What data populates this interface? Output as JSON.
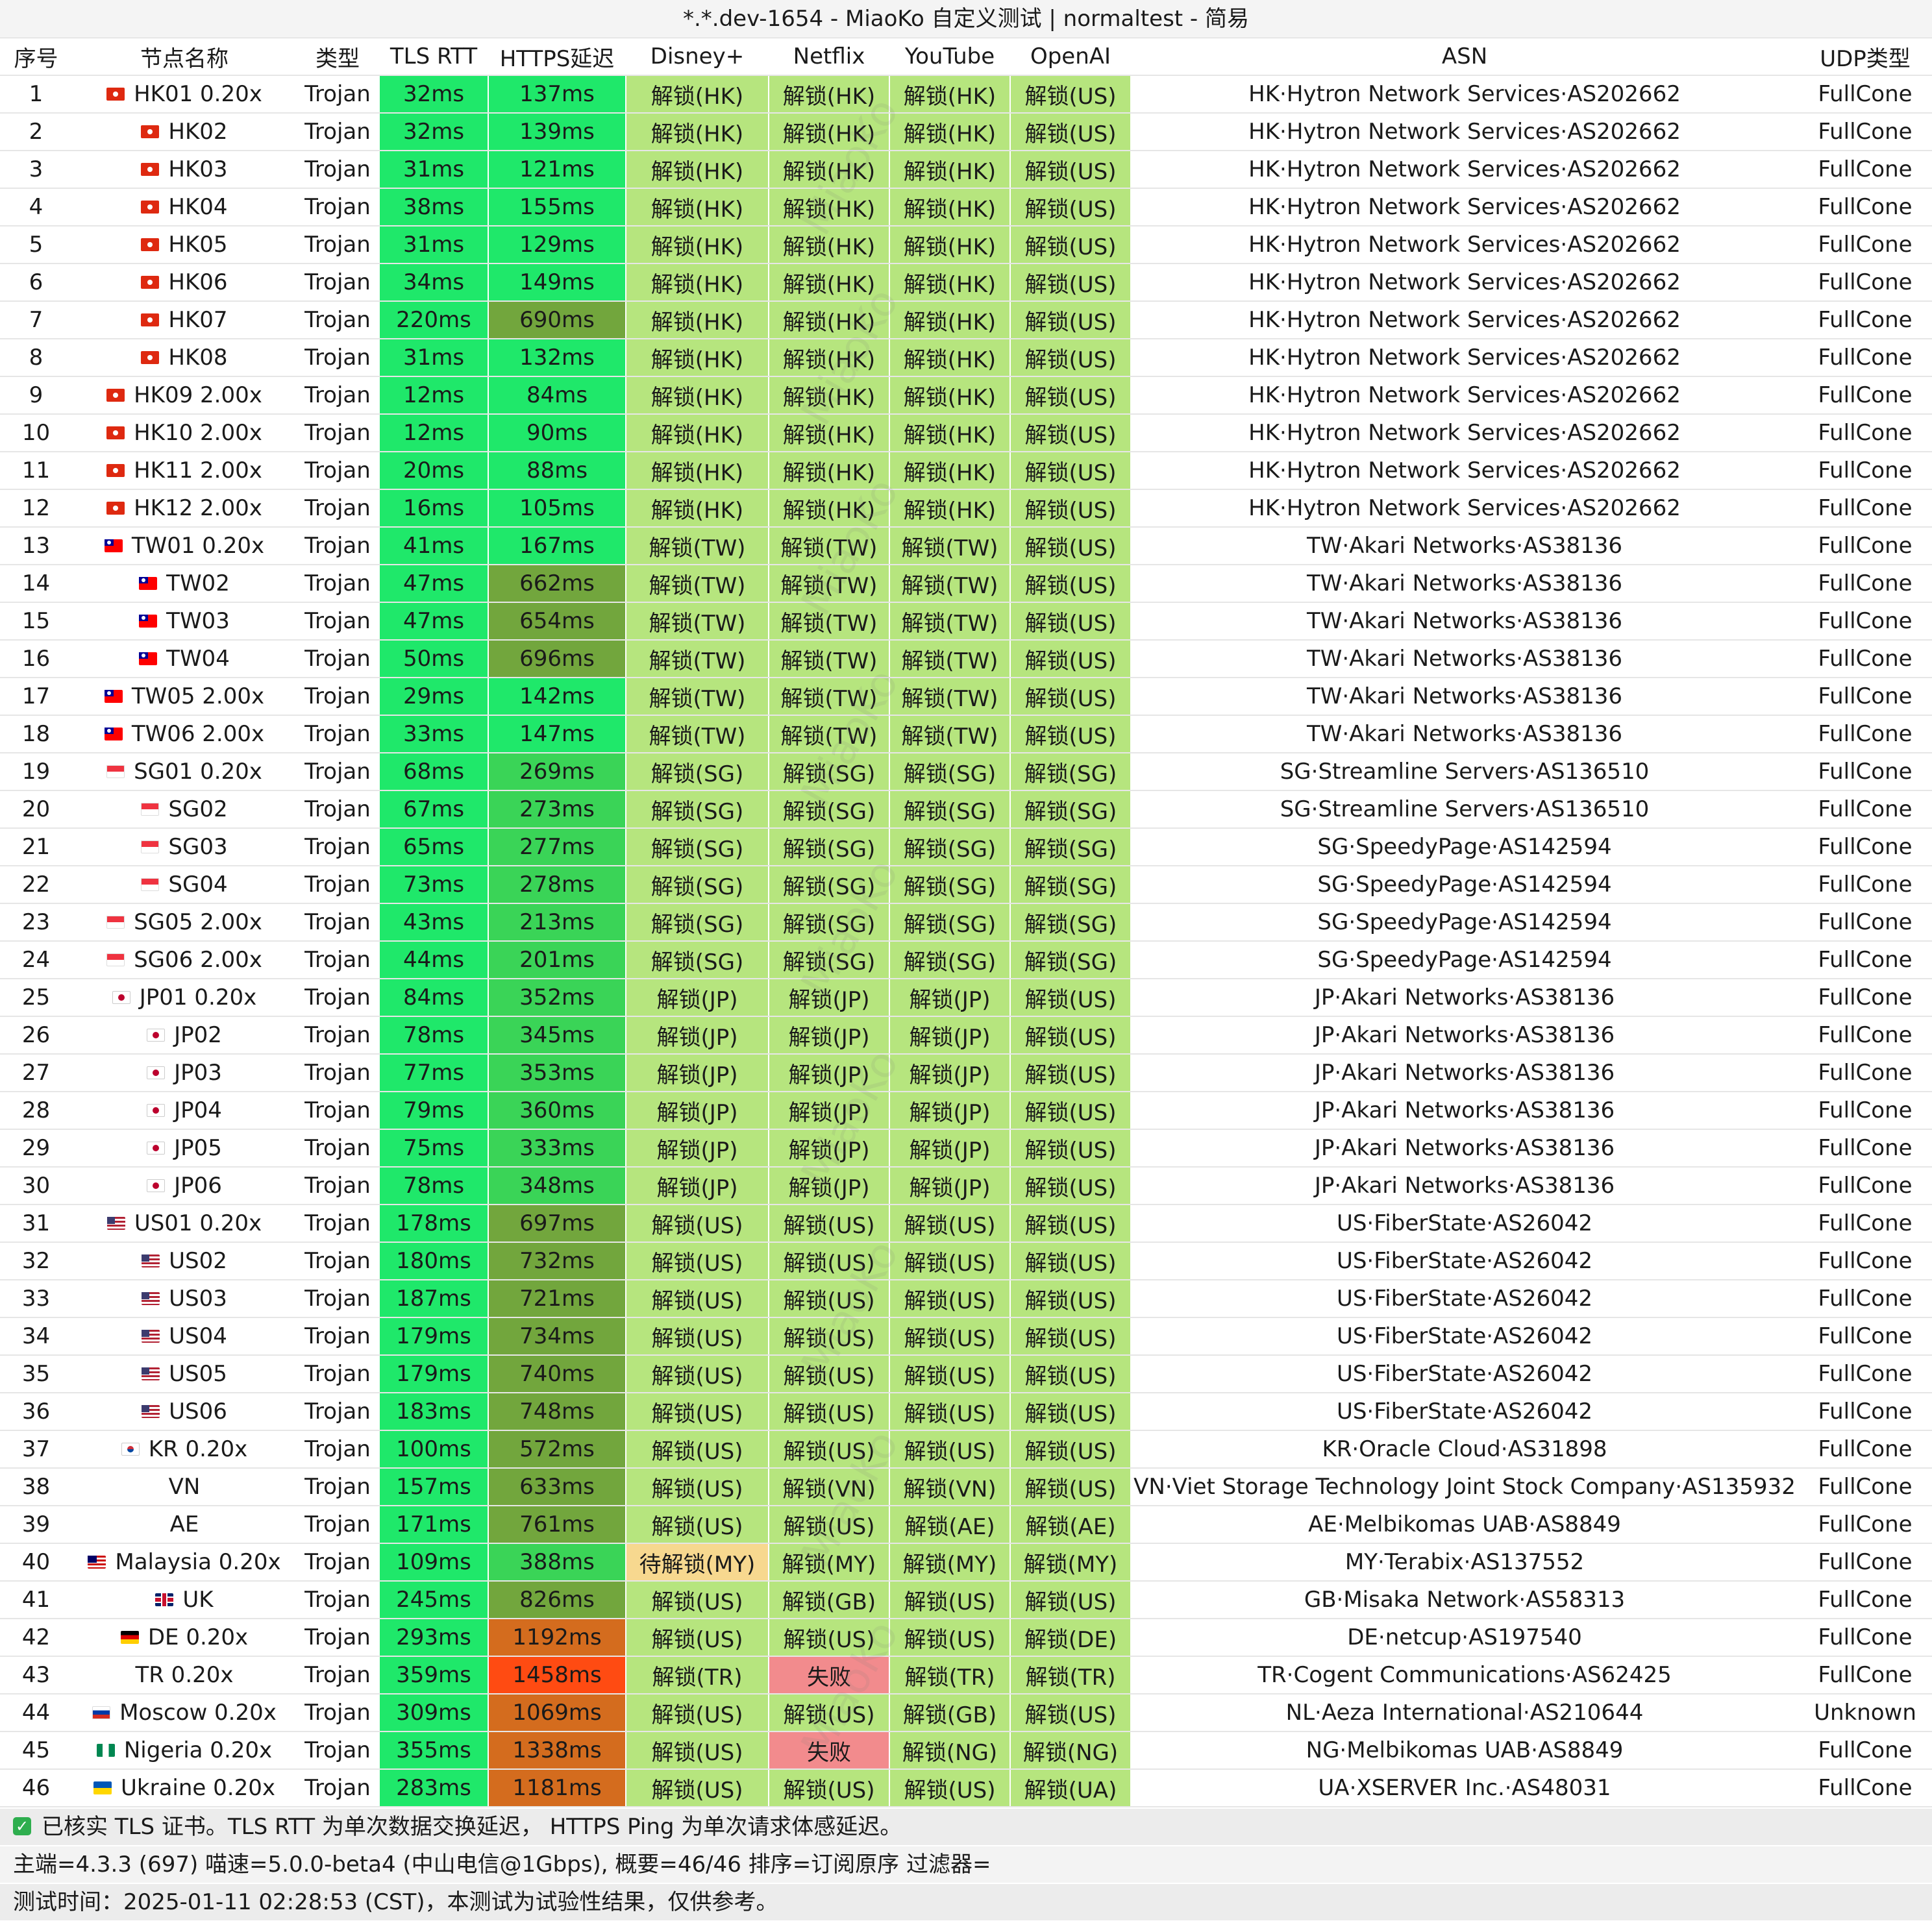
{
  "title": "*.*.dev-1654 - MiaoKo 自定义测试 | normaltest - 简易",
  "headers": [
    "序号",
    "节点名称",
    "类型",
    "TLS RTT",
    "HTTPS延迟",
    "Disney+",
    "Netflix",
    "YouTube",
    "OpenAI",
    "ASN",
    "UDP类型"
  ],
  "colors": {
    "tls_green": "#1fe86a",
    "unlock_green": "#b6e57e",
    "pending_yellow": "#f7d88f",
    "fail_red": "#f28b8d",
    "https_scale": [
      "#1fe86a",
      "#3ad457",
      "#72a63d",
      "#d46c1e",
      "#ff4b12"
    ]
  },
  "rows": [
    {
      "no": "1",
      "flag": "hk",
      "name": "HK01 0.20x",
      "type": "Trojan",
      "tls": "32ms",
      "https": "137ms",
      "https_level": 0,
      "disney": "解锁(HK)",
      "netflix": "解锁(HK)",
      "youtube": "解锁(HK)",
      "openai": "解锁(US)",
      "asn": "HK·Hytron Network Services·AS202662",
      "udp": "FullCone"
    },
    {
      "no": "2",
      "flag": "hk",
      "name": "HK02",
      "type": "Trojan",
      "tls": "32ms",
      "https": "139ms",
      "https_level": 0,
      "disney": "解锁(HK)",
      "netflix": "解锁(HK)",
      "youtube": "解锁(HK)",
      "openai": "解锁(US)",
      "asn": "HK·Hytron Network Services·AS202662",
      "udp": "FullCone"
    },
    {
      "no": "3",
      "flag": "hk",
      "name": "HK03",
      "type": "Trojan",
      "tls": "31ms",
      "https": "121ms",
      "https_level": 0,
      "disney": "解锁(HK)",
      "netflix": "解锁(HK)",
      "youtube": "解锁(HK)",
      "openai": "解锁(US)",
      "asn": "HK·Hytron Network Services·AS202662",
      "udp": "FullCone"
    },
    {
      "no": "4",
      "flag": "hk",
      "name": "HK04",
      "type": "Trojan",
      "tls": "38ms",
      "https": "155ms",
      "https_level": 0,
      "disney": "解锁(HK)",
      "netflix": "解锁(HK)",
      "youtube": "解锁(HK)",
      "openai": "解锁(US)",
      "asn": "HK·Hytron Network Services·AS202662",
      "udp": "FullCone"
    },
    {
      "no": "5",
      "flag": "hk",
      "name": "HK05",
      "type": "Trojan",
      "tls": "31ms",
      "https": "129ms",
      "https_level": 0,
      "disney": "解锁(HK)",
      "netflix": "解锁(HK)",
      "youtube": "解锁(HK)",
      "openai": "解锁(US)",
      "asn": "HK·Hytron Network Services·AS202662",
      "udp": "FullCone"
    },
    {
      "no": "6",
      "flag": "hk",
      "name": "HK06",
      "type": "Trojan",
      "tls": "34ms",
      "https": "149ms",
      "https_level": 0,
      "disney": "解锁(HK)",
      "netflix": "解锁(HK)",
      "youtube": "解锁(HK)",
      "openai": "解锁(US)",
      "asn": "HK·Hytron Network Services·AS202662",
      "udp": "FullCone"
    },
    {
      "no": "7",
      "flag": "hk",
      "name": "HK07",
      "type": "Trojan",
      "tls": "220ms",
      "https": "690ms",
      "https_level": 2,
      "disney": "解锁(HK)",
      "netflix": "解锁(HK)",
      "youtube": "解锁(HK)",
      "openai": "解锁(US)",
      "asn": "HK·Hytron Network Services·AS202662",
      "udp": "FullCone"
    },
    {
      "no": "8",
      "flag": "hk",
      "name": "HK08",
      "type": "Trojan",
      "tls": "31ms",
      "https": "132ms",
      "https_level": 0,
      "disney": "解锁(HK)",
      "netflix": "解锁(HK)",
      "youtube": "解锁(HK)",
      "openai": "解锁(US)",
      "asn": "HK·Hytron Network Services·AS202662",
      "udp": "FullCone"
    },
    {
      "no": "9",
      "flag": "hk",
      "name": "HK09 2.00x",
      "type": "Trojan",
      "tls": "12ms",
      "https": "84ms",
      "https_level": 0,
      "disney": "解锁(HK)",
      "netflix": "解锁(HK)",
      "youtube": "解锁(HK)",
      "openai": "解锁(US)",
      "asn": "HK·Hytron Network Services·AS202662",
      "udp": "FullCone"
    },
    {
      "no": "10",
      "flag": "hk",
      "name": "HK10 2.00x",
      "type": "Trojan",
      "tls": "12ms",
      "https": "90ms",
      "https_level": 0,
      "disney": "解锁(HK)",
      "netflix": "解锁(HK)",
      "youtube": "解锁(HK)",
      "openai": "解锁(US)",
      "asn": "HK·Hytron Network Services·AS202662",
      "udp": "FullCone"
    },
    {
      "no": "11",
      "flag": "hk",
      "name": "HK11 2.00x",
      "type": "Trojan",
      "tls": "20ms",
      "https": "88ms",
      "https_level": 0,
      "disney": "解锁(HK)",
      "netflix": "解锁(HK)",
      "youtube": "解锁(HK)",
      "openai": "解锁(US)",
      "asn": "HK·Hytron Network Services·AS202662",
      "udp": "FullCone"
    },
    {
      "no": "12",
      "flag": "hk",
      "name": "HK12 2.00x",
      "type": "Trojan",
      "tls": "16ms",
      "https": "105ms",
      "https_level": 0,
      "disney": "解锁(HK)",
      "netflix": "解锁(HK)",
      "youtube": "解锁(HK)",
      "openai": "解锁(US)",
      "asn": "HK·Hytron Network Services·AS202662",
      "udp": "FullCone"
    },
    {
      "no": "13",
      "flag": "tw",
      "name": "TW01 0.20x",
      "type": "Trojan",
      "tls": "41ms",
      "https": "167ms",
      "https_level": 0,
      "disney": "解锁(TW)",
      "netflix": "解锁(TW)",
      "youtube": "解锁(TW)",
      "openai": "解锁(US)",
      "asn": "TW·Akari Networks·AS38136",
      "udp": "FullCone"
    },
    {
      "no": "14",
      "flag": "tw",
      "name": "TW02",
      "type": "Trojan",
      "tls": "47ms",
      "https": "662ms",
      "https_level": 2,
      "disney": "解锁(TW)",
      "netflix": "解锁(TW)",
      "youtube": "解锁(TW)",
      "openai": "解锁(US)",
      "asn": "TW·Akari Networks·AS38136",
      "udp": "FullCone"
    },
    {
      "no": "15",
      "flag": "tw",
      "name": "TW03",
      "type": "Trojan",
      "tls": "47ms",
      "https": "654ms",
      "https_level": 2,
      "disney": "解锁(TW)",
      "netflix": "解锁(TW)",
      "youtube": "解锁(TW)",
      "openai": "解锁(US)",
      "asn": "TW·Akari Networks·AS38136",
      "udp": "FullCone"
    },
    {
      "no": "16",
      "flag": "tw",
      "name": "TW04",
      "type": "Trojan",
      "tls": "50ms",
      "https": "696ms",
      "https_level": 2,
      "disney": "解锁(TW)",
      "netflix": "解锁(TW)",
      "youtube": "解锁(TW)",
      "openai": "解锁(US)",
      "asn": "TW·Akari Networks·AS38136",
      "udp": "FullCone"
    },
    {
      "no": "17",
      "flag": "tw",
      "name": "TW05 2.00x",
      "type": "Trojan",
      "tls": "29ms",
      "https": "142ms",
      "https_level": 0,
      "disney": "解锁(TW)",
      "netflix": "解锁(TW)",
      "youtube": "解锁(TW)",
      "openai": "解锁(US)",
      "asn": "TW·Akari Networks·AS38136",
      "udp": "FullCone"
    },
    {
      "no": "18",
      "flag": "tw",
      "name": "TW06 2.00x",
      "type": "Trojan",
      "tls": "33ms",
      "https": "147ms",
      "https_level": 0,
      "disney": "解锁(TW)",
      "netflix": "解锁(TW)",
      "youtube": "解锁(TW)",
      "openai": "解锁(US)",
      "asn": "TW·Akari Networks·AS38136",
      "udp": "FullCone"
    },
    {
      "no": "19",
      "flag": "sg",
      "name": "SG01 0.20x",
      "type": "Trojan",
      "tls": "68ms",
      "https": "269ms",
      "https_level": 1,
      "disney": "解锁(SG)",
      "netflix": "解锁(SG)",
      "youtube": "解锁(SG)",
      "openai": "解锁(SG)",
      "asn": "SG·Streamline Servers·AS136510",
      "udp": "FullCone"
    },
    {
      "no": "20",
      "flag": "sg",
      "name": "SG02",
      "type": "Trojan",
      "tls": "67ms",
      "https": "273ms",
      "https_level": 1,
      "disney": "解锁(SG)",
      "netflix": "解锁(SG)",
      "youtube": "解锁(SG)",
      "openai": "解锁(SG)",
      "asn": "SG·Streamline Servers·AS136510",
      "udp": "FullCone"
    },
    {
      "no": "21",
      "flag": "sg",
      "name": "SG03",
      "type": "Trojan",
      "tls": "65ms",
      "https": "277ms",
      "https_level": 1,
      "disney": "解锁(SG)",
      "netflix": "解锁(SG)",
      "youtube": "解锁(SG)",
      "openai": "解锁(SG)",
      "asn": "SG·SpeedyPage·AS142594",
      "udp": "FullCone"
    },
    {
      "no": "22",
      "flag": "sg",
      "name": "SG04",
      "type": "Trojan",
      "tls": "73ms",
      "https": "278ms",
      "https_level": 1,
      "disney": "解锁(SG)",
      "netflix": "解锁(SG)",
      "youtube": "解锁(SG)",
      "openai": "解锁(SG)",
      "asn": "SG·SpeedyPage·AS142594",
      "udp": "FullCone"
    },
    {
      "no": "23",
      "flag": "sg",
      "name": "SG05 2.00x",
      "type": "Trojan",
      "tls": "43ms",
      "https": "213ms",
      "https_level": 1,
      "disney": "解锁(SG)",
      "netflix": "解锁(SG)",
      "youtube": "解锁(SG)",
      "openai": "解锁(SG)",
      "asn": "SG·SpeedyPage·AS142594",
      "udp": "FullCone"
    },
    {
      "no": "24",
      "flag": "sg",
      "name": "SG06 2.00x",
      "type": "Trojan",
      "tls": "44ms",
      "https": "201ms",
      "https_level": 1,
      "disney": "解锁(SG)",
      "netflix": "解锁(SG)",
      "youtube": "解锁(SG)",
      "openai": "解锁(SG)",
      "asn": "SG·SpeedyPage·AS142594",
      "udp": "FullCone"
    },
    {
      "no": "25",
      "flag": "jp",
      "name": "JP01 0.20x",
      "type": "Trojan",
      "tls": "84ms",
      "https": "352ms",
      "https_level": 1,
      "disney": "解锁(JP)",
      "netflix": "解锁(JP)",
      "youtube": "解锁(JP)",
      "openai": "解锁(US)",
      "asn": "JP·Akari Networks·AS38136",
      "udp": "FullCone"
    },
    {
      "no": "26",
      "flag": "jp",
      "name": "JP02",
      "type": "Trojan",
      "tls": "78ms",
      "https": "345ms",
      "https_level": 1,
      "disney": "解锁(JP)",
      "netflix": "解锁(JP)",
      "youtube": "解锁(JP)",
      "openai": "解锁(US)",
      "asn": "JP·Akari Networks·AS38136",
      "udp": "FullCone"
    },
    {
      "no": "27",
      "flag": "jp",
      "name": "JP03",
      "type": "Trojan",
      "tls": "77ms",
      "https": "353ms",
      "https_level": 1,
      "disney": "解锁(JP)",
      "netflix": "解锁(JP)",
      "youtube": "解锁(JP)",
      "openai": "解锁(US)",
      "asn": "JP·Akari Networks·AS38136",
      "udp": "FullCone"
    },
    {
      "no": "28",
      "flag": "jp",
      "name": "JP04",
      "type": "Trojan",
      "tls": "79ms",
      "https": "360ms",
      "https_level": 1,
      "disney": "解锁(JP)",
      "netflix": "解锁(JP)",
      "youtube": "解锁(JP)",
      "openai": "解锁(US)",
      "asn": "JP·Akari Networks·AS38136",
      "udp": "FullCone"
    },
    {
      "no": "29",
      "flag": "jp",
      "name": "JP05",
      "type": "Trojan",
      "tls": "75ms",
      "https": "333ms",
      "https_level": 1,
      "disney": "解锁(JP)",
      "netflix": "解锁(JP)",
      "youtube": "解锁(JP)",
      "openai": "解锁(US)",
      "asn": "JP·Akari Networks·AS38136",
      "udp": "FullCone"
    },
    {
      "no": "30",
      "flag": "jp",
      "name": "JP06",
      "type": "Trojan",
      "tls": "78ms",
      "https": "348ms",
      "https_level": 1,
      "disney": "解锁(JP)",
      "netflix": "解锁(JP)",
      "youtube": "解锁(JP)",
      "openai": "解锁(US)",
      "asn": "JP·Akari Networks·AS38136",
      "udp": "FullCone"
    },
    {
      "no": "31",
      "flag": "us",
      "name": "US01 0.20x",
      "type": "Trojan",
      "tls": "178ms",
      "https": "697ms",
      "https_level": 2,
      "disney": "解锁(US)",
      "netflix": "解锁(US)",
      "youtube": "解锁(US)",
      "openai": "解锁(US)",
      "asn": "US·FiberState·AS26042",
      "udp": "FullCone"
    },
    {
      "no": "32",
      "flag": "us",
      "name": "US02",
      "type": "Trojan",
      "tls": "180ms",
      "https": "732ms",
      "https_level": 2,
      "disney": "解锁(US)",
      "netflix": "解锁(US)",
      "youtube": "解锁(US)",
      "openai": "解锁(US)",
      "asn": "US·FiberState·AS26042",
      "udp": "FullCone"
    },
    {
      "no": "33",
      "flag": "us",
      "name": "US03",
      "type": "Trojan",
      "tls": "187ms",
      "https": "721ms",
      "https_level": 2,
      "disney": "解锁(US)",
      "netflix": "解锁(US)",
      "youtube": "解锁(US)",
      "openai": "解锁(US)",
      "asn": "US·FiberState·AS26042",
      "udp": "FullCone"
    },
    {
      "no": "34",
      "flag": "us",
      "name": "US04",
      "type": "Trojan",
      "tls": "179ms",
      "https": "734ms",
      "https_level": 2,
      "disney": "解锁(US)",
      "netflix": "解锁(US)",
      "youtube": "解锁(US)",
      "openai": "解锁(US)",
      "asn": "US·FiberState·AS26042",
      "udp": "FullCone"
    },
    {
      "no": "35",
      "flag": "us",
      "name": "US05",
      "type": "Trojan",
      "tls": "179ms",
      "https": "740ms",
      "https_level": 2,
      "disney": "解锁(US)",
      "netflix": "解锁(US)",
      "youtube": "解锁(US)",
      "openai": "解锁(US)",
      "asn": "US·FiberState·AS26042",
      "udp": "FullCone"
    },
    {
      "no": "36",
      "flag": "us",
      "name": "US06",
      "type": "Trojan",
      "tls": "183ms",
      "https": "748ms",
      "https_level": 2,
      "disney": "解锁(US)",
      "netflix": "解锁(US)",
      "youtube": "解锁(US)",
      "openai": "解锁(US)",
      "asn": "US·FiberState·AS26042",
      "udp": "FullCone"
    },
    {
      "no": "37",
      "flag": "kr",
      "name": "KR 0.20x",
      "type": "Trojan",
      "tls": "100ms",
      "https": "572ms",
      "https_level": 2,
      "disney": "解锁(US)",
      "netflix": "解锁(US)",
      "youtube": "解锁(US)",
      "openai": "解锁(US)",
      "asn": "KR·Oracle Cloud·AS31898",
      "udp": "FullCone"
    },
    {
      "no": "38",
      "flag": "none",
      "name": "VN",
      "type": "Trojan",
      "tls": "157ms",
      "https": "633ms",
      "https_level": 2,
      "disney": "解锁(US)",
      "netflix": "解锁(VN)",
      "youtube": "解锁(VN)",
      "openai": "解锁(US)",
      "asn": "VN·Viet Storage Technology Joint Stock Company·AS135932",
      "udp": "FullCone"
    },
    {
      "no": "39",
      "flag": "none",
      "name": "AE",
      "type": "Trojan",
      "tls": "171ms",
      "https": "761ms",
      "https_level": 2,
      "disney": "解锁(US)",
      "netflix": "解锁(US)",
      "youtube": "解锁(AE)",
      "openai": "解锁(AE)",
      "asn": "AE·Melbikomas UAB·AS8849",
      "udp": "FullCone"
    },
    {
      "no": "40",
      "flag": "my",
      "name": "Malaysia 0.20x",
      "type": "Trojan",
      "tls": "109ms",
      "https": "388ms",
      "https_level": 1,
      "disney": "待解锁(MY)",
      "disney_state": "pending",
      "netflix": "解锁(MY)",
      "youtube": "解锁(MY)",
      "openai": "解锁(MY)",
      "asn": "MY·Terabix·AS137552",
      "udp": "FullCone"
    },
    {
      "no": "41",
      "flag": "uk",
      "name": "UK",
      "type": "Trojan",
      "tls": "245ms",
      "https": "826ms",
      "https_level": 2,
      "disney": "解锁(US)",
      "netflix": "解锁(GB)",
      "youtube": "解锁(US)",
      "openai": "解锁(US)",
      "asn": "GB·Misaka Network·AS58313",
      "udp": "FullCone"
    },
    {
      "no": "42",
      "flag": "de",
      "name": "DE 0.20x",
      "type": "Trojan",
      "tls": "293ms",
      "https": "1192ms",
      "https_level": 3,
      "disney": "解锁(US)",
      "netflix": "解锁(US)",
      "youtube": "解锁(US)",
      "openai": "解锁(DE)",
      "asn": "DE·netcup·AS197540",
      "udp": "FullCone"
    },
    {
      "no": "43",
      "flag": "none",
      "name": "TR 0.20x",
      "type": "Trojan",
      "tls": "359ms",
      "https": "1458ms",
      "https_level": 4,
      "disney": "解锁(TR)",
      "netflix": "失败",
      "netflix_state": "fail",
      "youtube": "解锁(TR)",
      "openai": "解锁(TR)",
      "asn": "TR·Cogent Communications·AS62425",
      "udp": "FullCone"
    },
    {
      "no": "44",
      "flag": "ru",
      "name": "Moscow 0.20x",
      "type": "Trojan",
      "tls": "309ms",
      "https": "1069ms",
      "https_level": 3,
      "disney": "解锁(US)",
      "netflix": "解锁(US)",
      "youtube": "解锁(GB)",
      "openai": "解锁(US)",
      "asn": "NL·Aeza International·AS210644",
      "udp": "Unknown"
    },
    {
      "no": "45",
      "flag": "ng",
      "name": "Nigeria 0.20x",
      "type": "Trojan",
      "tls": "355ms",
      "https": "1338ms",
      "https_level": 3,
      "disney": "解锁(US)",
      "netflix": "失败",
      "netflix_state": "fail",
      "youtube": "解锁(NG)",
      "openai": "解锁(NG)",
      "asn": "NG·Melbikomas UAB·AS8849",
      "udp": "FullCone"
    },
    {
      "no": "46",
      "flag": "ua",
      "name": "Ukraine 0.20x",
      "type": "Trojan",
      "tls": "283ms",
      "https": "1181ms",
      "https_level": 3,
      "disney": "解锁(US)",
      "netflix": "解锁(US)",
      "youtube": "解锁(US)",
      "openai": "解锁(UA)",
      "asn": "UA·XSERVER Inc.·AS48031",
      "udp": "FullCone"
    }
  ],
  "footer": {
    "line1": "已核实 TLS 证书。TLS RTT 为单次数据交换延迟， HTTPS Ping 为单次请求体感延迟。",
    "line2": "主端=4.3.3 (697) 喵速=5.0.0-beta4 (中山电信@1Gbps), 概要=46/46 排序=订阅原序 过滤器=",
    "line3": "测试时间：2025-01-11 02:28:53 (CST)，本测试为试验性结果，仅供参考。"
  },
  "watermark": {
    "text": "MiaoKo",
    "count": 9
  }
}
